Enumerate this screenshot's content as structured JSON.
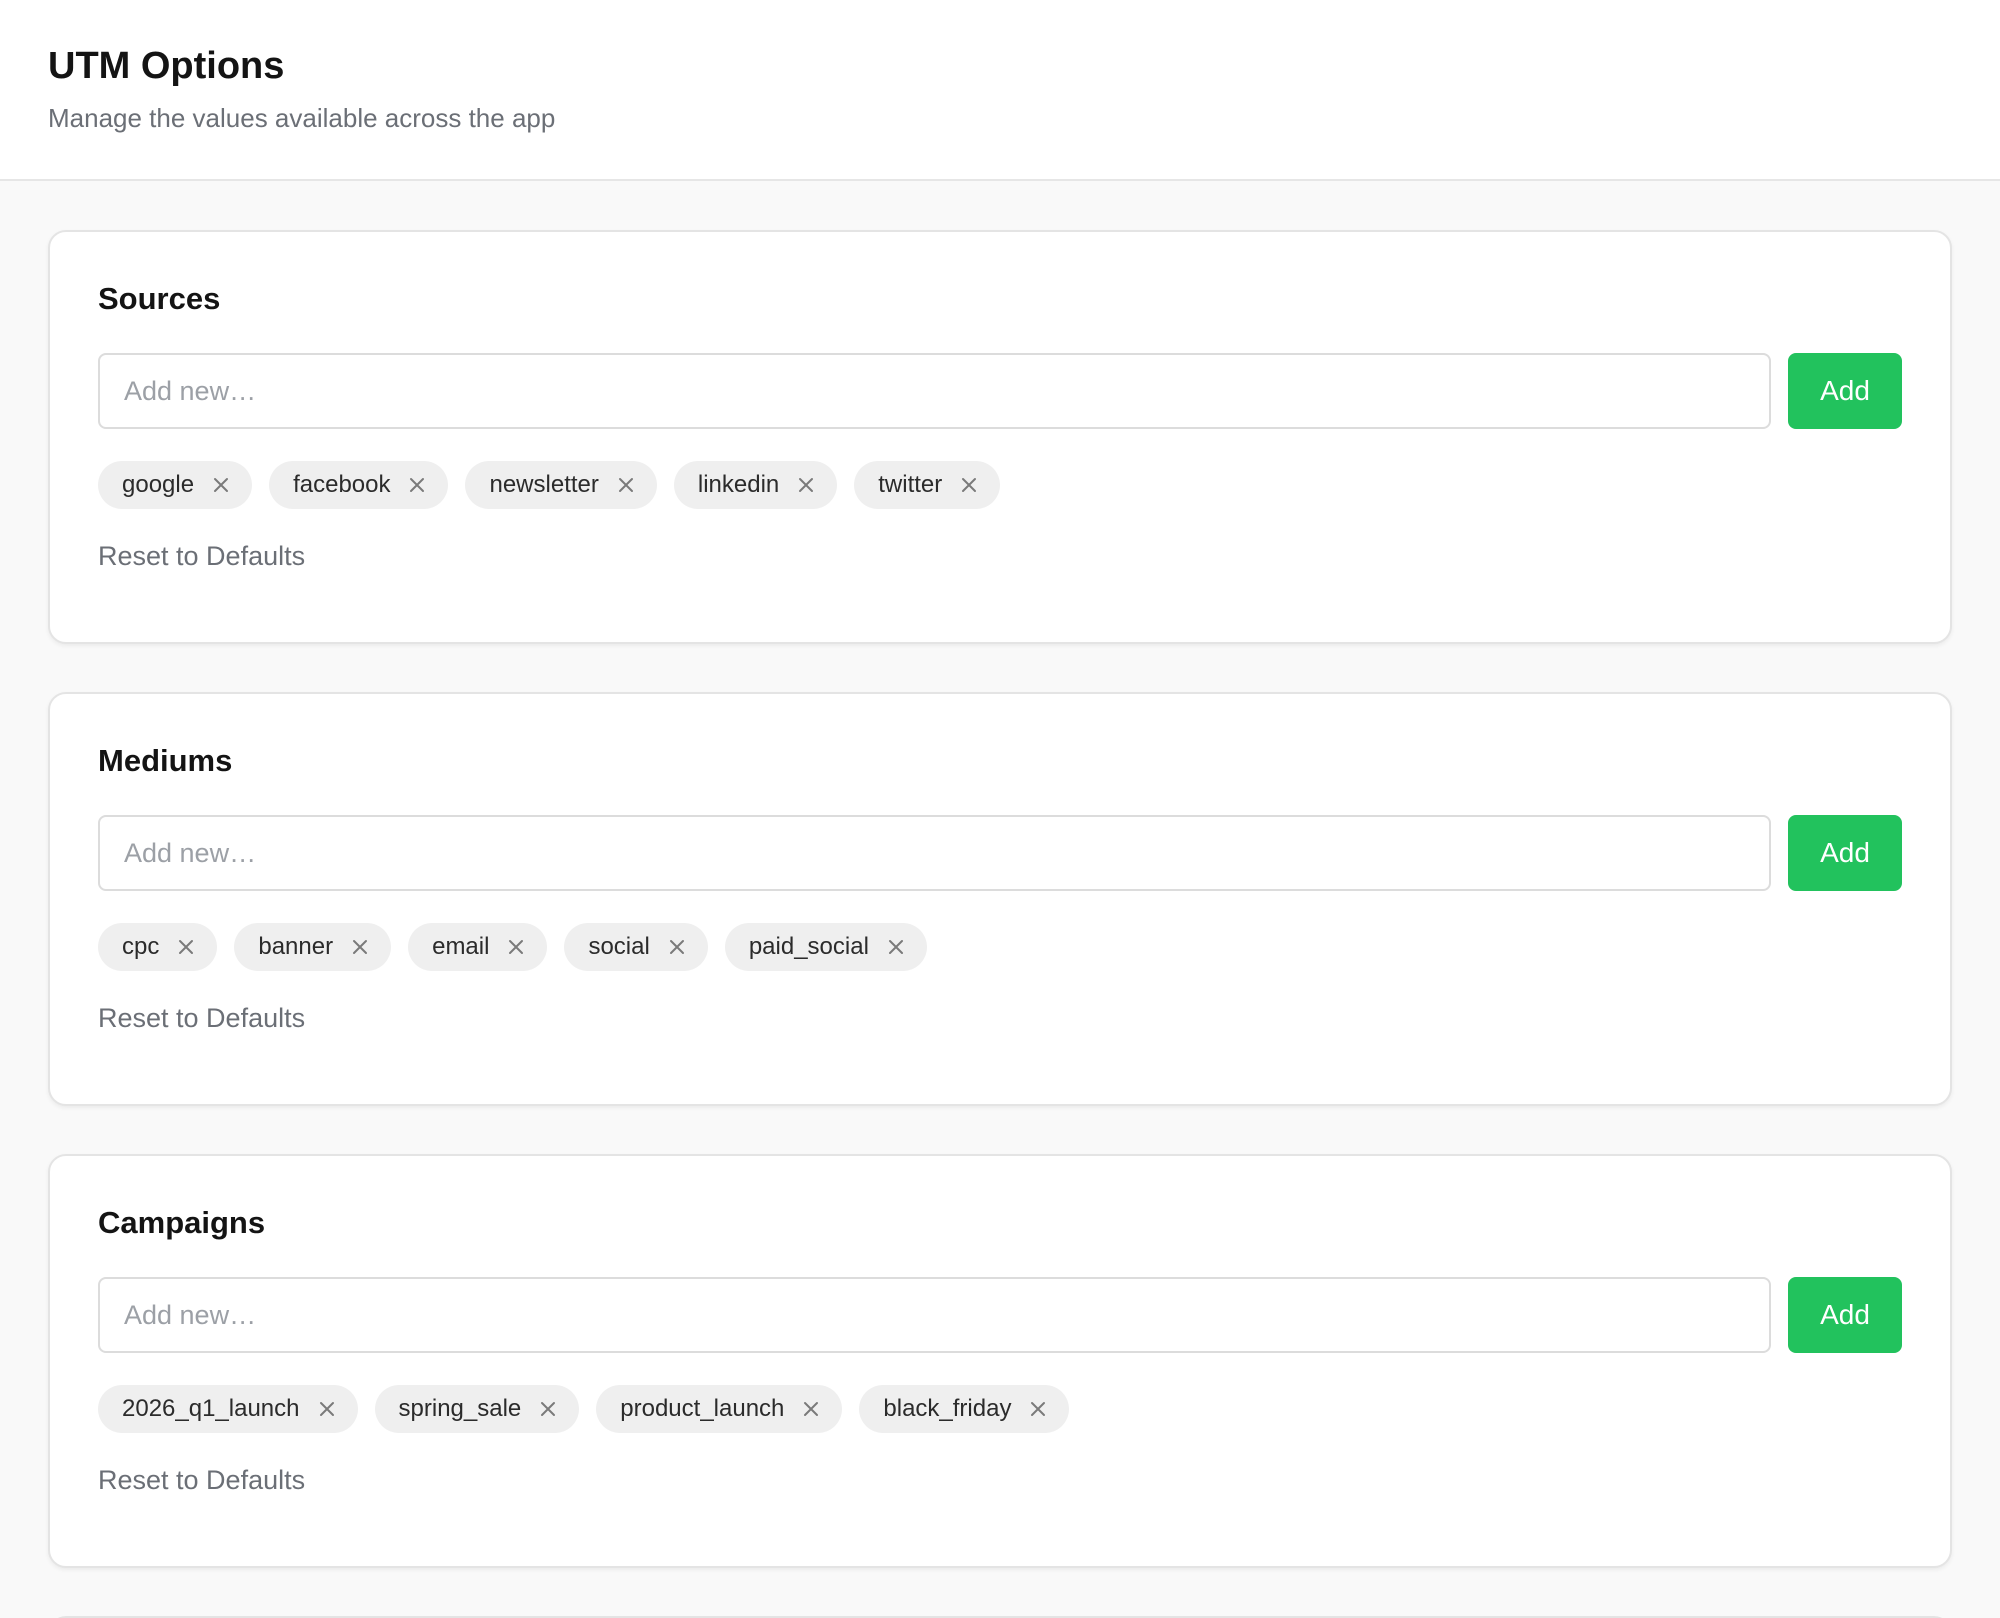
{
  "header": {
    "title": "UTM Options",
    "subtitle": "Manage the values available across the app"
  },
  "sections": [
    {
      "title": "Sources",
      "input_placeholder": "Add new…",
      "add_label": "Add",
      "chips": [
        "google",
        "facebook",
        "newsletter",
        "linkedin",
        "twitter"
      ],
      "reset_label": "Reset to Defaults"
    },
    {
      "title": "Mediums",
      "input_placeholder": "Add new…",
      "add_label": "Add",
      "chips": [
        "cpc",
        "banner",
        "email",
        "social",
        "paid_social"
      ],
      "reset_label": "Reset to Defaults"
    },
    {
      "title": "Campaigns",
      "input_placeholder": "Add new…",
      "add_label": "Add",
      "chips": [
        "2026_q1_launch",
        "spring_sale",
        "product_launch",
        "black_friday"
      ],
      "reset_label": "Reset to Defaults"
    }
  ],
  "icons": {
    "chip_remove": "close-icon"
  },
  "colors": {
    "accent": "#22c25d",
    "chip_bg": "#efefef",
    "muted_text": "#6b6f76"
  }
}
